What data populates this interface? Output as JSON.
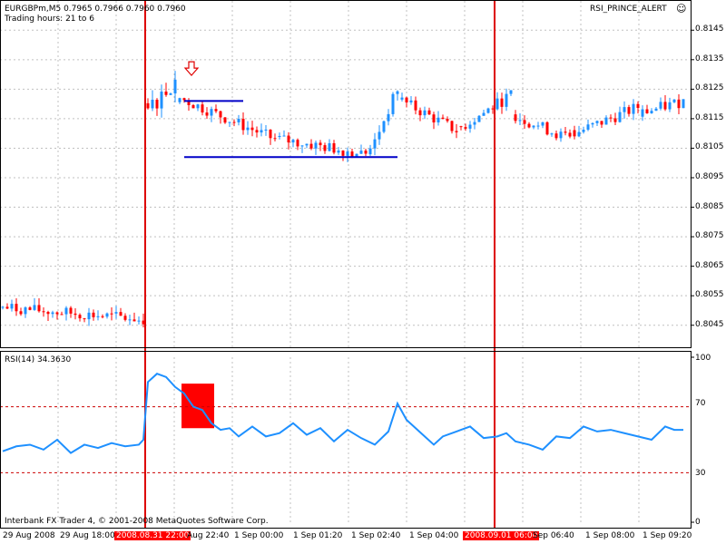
{
  "header": {
    "symbol_line": "EURGBPm,M5  0.7965 0.7966 0.7960 0.7960",
    "trading_hours": "Trading hours: 21 to 6",
    "indicator_name": "RSI_PRINCE_ALERT",
    "indicator_icon": "smiley-icon"
  },
  "rsi_panel": {
    "label": "RSI(14) 34.3630",
    "levels": [
      "100",
      "70",
      "30",
      "0"
    ]
  },
  "footer": {
    "copyright": "Interbank FX Trader 4, © 2001-2008 MetaQuotes Software Corp."
  },
  "time_axis": {
    "labels": [
      "29 Aug 2008",
      "29 Aug 18:00",
      "2008.08.31 22:00",
      "Aug 22:40",
      "1 Sep 00:00",
      "1 Sep 01:20",
      "1 Sep 02:40",
      "1 Sep 04:00",
      "2008.09.01 06:00",
      "Sep 06:40",
      "1 Sep 08:00",
      "1 Sep 09:20"
    ],
    "highlighted": [
      "2008.08.31 22:00",
      "2008.09.01 06:00"
    ]
  },
  "colors": {
    "bull": "#1e90ff",
    "bear": "#ff0000",
    "rsi_line": "#1e90ff",
    "session_line": "#dd0000",
    "level_lines": "#0000c8",
    "grid": "#c0c0c0"
  },
  "chart_data": [
    {
      "type": "candlestick",
      "symbol": "EURGBPm",
      "timeframe": "M5",
      "price_ticks": [
        "0.8145",
        "0.8135",
        "0.8125",
        "0.8115",
        "0.8105",
        "0.8095",
        "0.8085",
        "0.8075",
        "0.8065",
        "0.8055",
        "0.8045"
      ],
      "ylim": [
        0.804,
        0.815
      ],
      "bar_count": 151,
      "segments": [
        {
          "from": 0,
          "to": 31,
          "start": 0.8051,
          "end": 0.8047,
          "noise": 0.0004
        },
        {
          "from": 32,
          "to": 38,
          "start": 0.8118,
          "end": 0.8128,
          "noise": 0.0006
        },
        {
          "from": 39,
          "to": 60,
          "start": 0.8122,
          "end": 0.8108,
          "noise": 0.0004
        },
        {
          "from": 61,
          "to": 80,
          "start": 0.8108,
          "end": 0.8103,
          "noise": 0.0004
        },
        {
          "from": 81,
          "to": 87,
          "start": 0.8104,
          "end": 0.8125,
          "noise": 0.0004
        },
        {
          "from": 88,
          "to": 100,
          "start": 0.8121,
          "end": 0.8111,
          "noise": 0.0004
        },
        {
          "from": 101,
          "to": 112,
          "start": 0.8112,
          "end": 0.8123,
          "noise": 0.0004
        },
        {
          "from": 113,
          "to": 125,
          "start": 0.8116,
          "end": 0.8108,
          "noise": 0.0004
        },
        {
          "from": 126,
          "to": 140,
          "start": 0.811,
          "end": 0.8119,
          "noise": 0.0004
        },
        {
          "from": 141,
          "to": 150,
          "start": 0.8117,
          "end": 0.8121,
          "noise": 0.0004
        }
      ],
      "session_markers": [
        32,
        109
      ],
      "level_lines": [
        {
          "price": 0.8121,
          "from": 40,
          "to": 53
        },
        {
          "price": 0.8102,
          "from": 40,
          "to": 87
        }
      ],
      "alert_arrow": {
        "bar": 41,
        "price": 0.813,
        "direction": "down"
      }
    },
    {
      "type": "line",
      "name": "RSI(14)",
      "ylim": [
        0,
        100
      ],
      "levels": [
        70,
        30
      ],
      "last_value": 34.363,
      "points": [
        [
          0,
          43
        ],
        [
          3,
          46
        ],
        [
          6,
          47
        ],
        [
          9,
          44
        ],
        [
          12,
          50
        ],
        [
          15,
          42
        ],
        [
          18,
          47
        ],
        [
          21,
          45
        ],
        [
          24,
          48
        ],
        [
          27,
          46
        ],
        [
          30,
          47
        ],
        [
          31,
          50
        ],
        [
          32,
          85
        ],
        [
          34,
          90
        ],
        [
          36,
          88
        ],
        [
          38,
          82
        ],
        [
          40,
          78
        ],
        [
          42,
          70
        ],
        [
          44,
          68
        ],
        [
          46,
          60
        ],
        [
          48,
          56
        ],
        [
          50,
          57
        ],
        [
          52,
          52
        ],
        [
          55,
          58
        ],
        [
          58,
          52
        ],
        [
          61,
          54
        ],
        [
          64,
          60
        ],
        [
          67,
          53
        ],
        [
          70,
          57
        ],
        [
          73,
          49
        ],
        [
          76,
          56
        ],
        [
          79,
          51
        ],
        [
          82,
          47
        ],
        [
          85,
          55
        ],
        [
          87,
          72
        ],
        [
          89,
          62
        ],
        [
          91,
          57
        ],
        [
          93,
          52
        ],
        [
          95,
          47
        ],
        [
          97,
          52
        ],
        [
          100,
          55
        ],
        [
          103,
          58
        ],
        [
          106,
          51
        ],
        [
          109,
          52
        ],
        [
          111,
          54
        ],
        [
          113,
          49
        ],
        [
          116,
          47
        ],
        [
          119,
          44
        ],
        [
          122,
          52
        ],
        [
          125,
          51
        ],
        [
          128,
          58
        ],
        [
          131,
          55
        ],
        [
          134,
          56
        ],
        [
          137,
          54
        ],
        [
          140,
          52
        ],
        [
          143,
          50
        ],
        [
          146,
          58
        ],
        [
          148,
          56
        ],
        [
          150,
          56
        ]
      ],
      "rsi_box": {
        "bar_from": 40,
        "bar_to": 46,
        "value_from": 57,
        "value_to": 84
      }
    }
  ]
}
